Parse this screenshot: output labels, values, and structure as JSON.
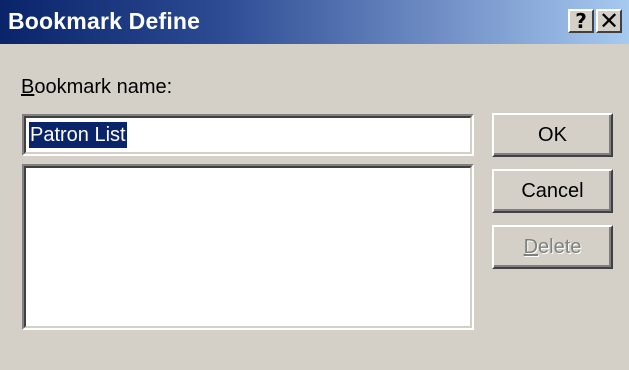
{
  "window": {
    "title": "Bookmark Define",
    "help_button": "?",
    "close_button": "✕"
  },
  "form": {
    "name_label_first": "B",
    "name_label_rest": "ookmark name:",
    "name_value": "Patron List",
    "list_items": []
  },
  "buttons": {
    "ok": "OK",
    "cancel": "Cancel",
    "delete_first": "D",
    "delete_rest": "elete",
    "delete_enabled": false
  },
  "colors": {
    "title_gradient_start": "#0a246a",
    "title_gradient_end": "#a6caf0",
    "dialog_face": "#d4d0c8",
    "selection": "#0a246a"
  }
}
